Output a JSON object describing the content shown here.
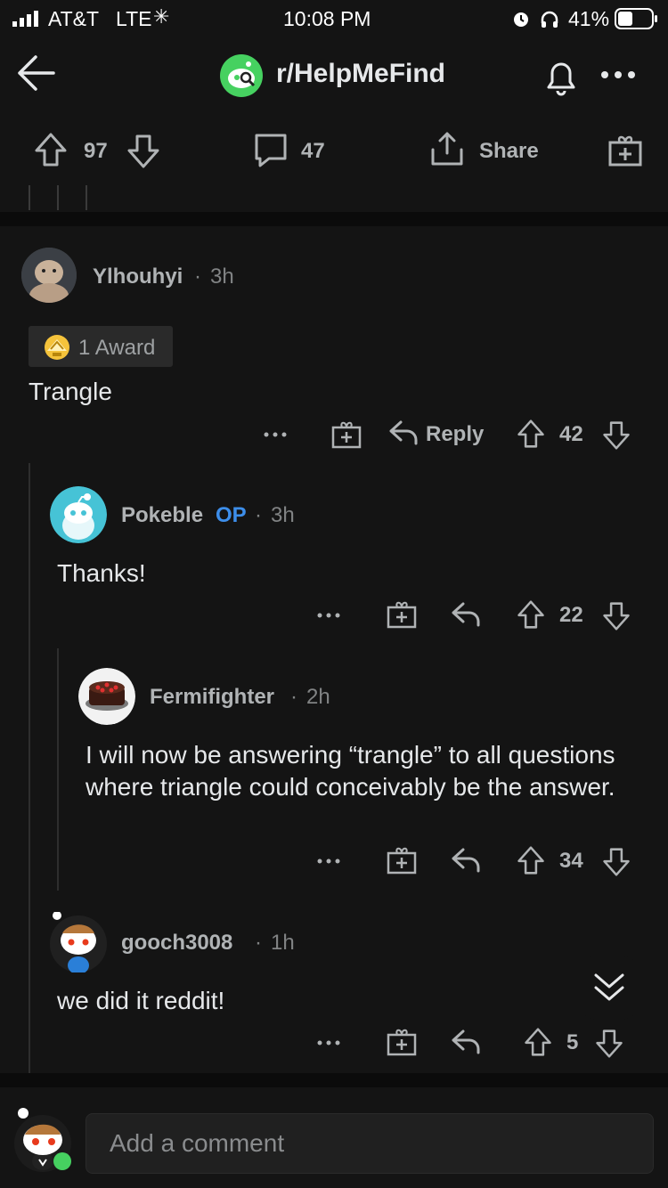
{
  "status_bar": {
    "carrier": "AT&T",
    "network": "LTE",
    "time": "10:08 PM",
    "battery": "41%"
  },
  "header": {
    "subreddit": "r/HelpMeFind"
  },
  "post_actions": {
    "upvotes": "97",
    "comments": "47",
    "share_label": "Share"
  },
  "comments": [
    {
      "author": "Ylhouhyi",
      "time": "3h",
      "award": "1 Award",
      "body": "Trangle",
      "reply_label": "Reply",
      "score": "42"
    },
    {
      "author": "Pokeble",
      "flair": "OP",
      "time": "3h",
      "body": "Thanks!",
      "score": "22"
    },
    {
      "author": "Fermifighter",
      "time": "2h",
      "body": "I will now be answering “trangle” to all questions where triangle could conceivably be the answer.",
      "score": "34"
    },
    {
      "author": "gooch3008",
      "time": "1h",
      "body": "we did it reddit!",
      "score": "5"
    }
  ],
  "composer": {
    "placeholder": "Add a comment"
  },
  "colors": {
    "background": "#141414",
    "op_blue": "#3d8eea",
    "snoo_teal": "#46c3d6",
    "online_green": "#46d160"
  }
}
